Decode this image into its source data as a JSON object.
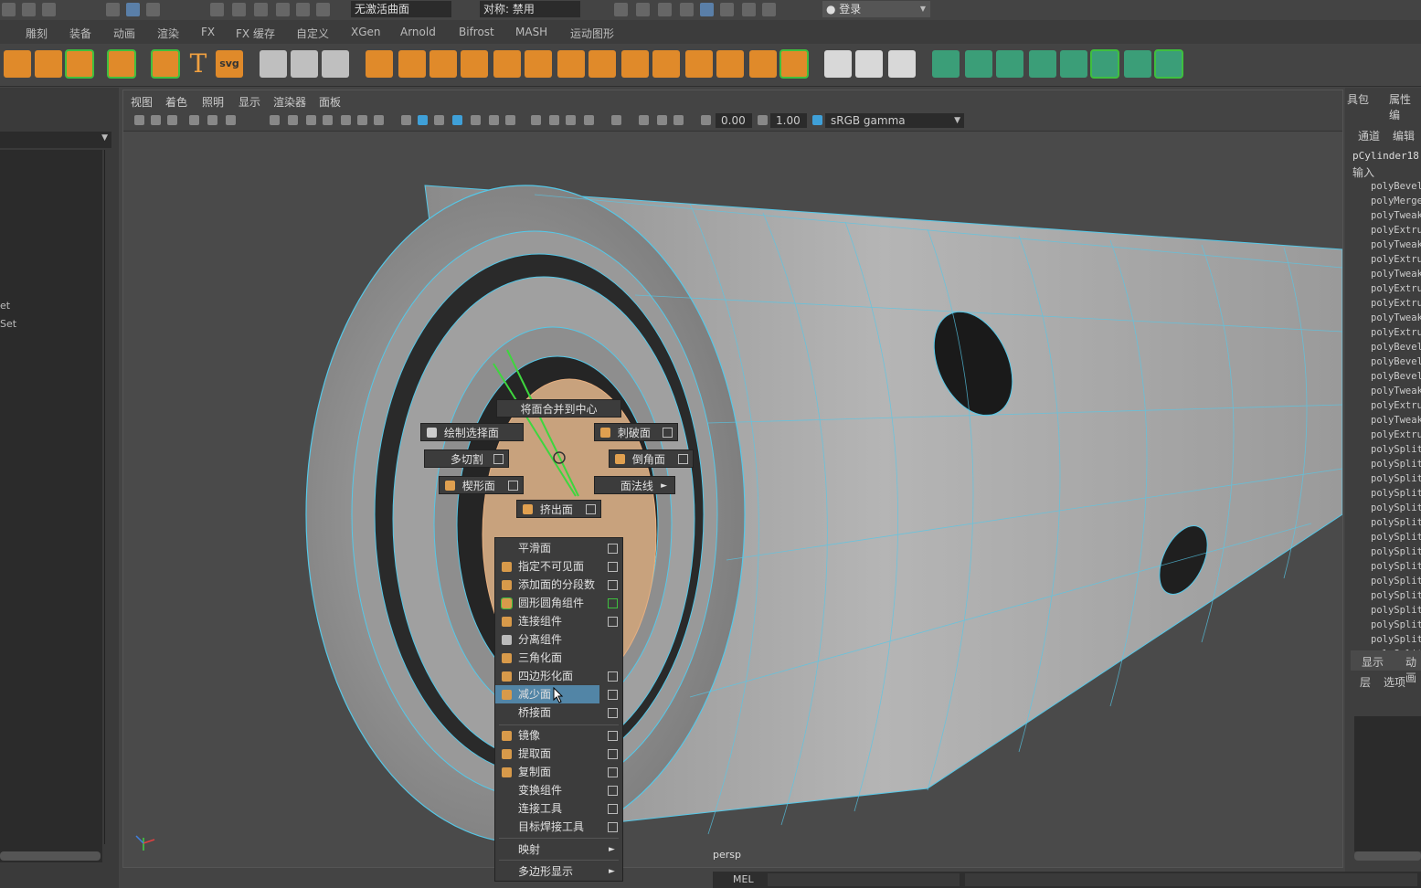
{
  "statusbar": {
    "surface_dropdown": "无激活曲面",
    "symmetry_dropdown": "对称: 禁用",
    "login": "登录"
  },
  "shelf_tabs": [
    "雕刻",
    "装备",
    "动画",
    "渲染",
    "FX",
    "FX 缓存",
    "自定义",
    "XGen",
    "Arnold",
    "Bifrost",
    "MASH",
    "运动图形"
  ],
  "shelf": {
    "text_tool": "T",
    "svg_tool": "svg"
  },
  "left_panel": {
    "items": [
      "et",
      "Set"
    ]
  },
  "viewport": {
    "menu": [
      "视图",
      "着色",
      "照明",
      "显示",
      "渲染器",
      "面板"
    ],
    "exposure": "0.00",
    "gamma": "1.00",
    "color_space": "sRGB gamma",
    "camera_label": "persp"
  },
  "marking_menu": {
    "north": "将面合并到中心",
    "northwest": "绘制选择面",
    "northeast": "刺破面",
    "west": "多切割",
    "east": "倒角面",
    "southwest": "楔形面",
    "southeast": "面法线",
    "south": "挤出面"
  },
  "popup_menu": {
    "items": [
      {
        "label": "平滑面",
        "box": true
      },
      {
        "label": "指定不可见面",
        "box": true
      },
      {
        "label": "添加面的分段数",
        "box": true
      },
      {
        "label": "圆形圆角组件",
        "box": true
      },
      {
        "label": "连接组件",
        "box": true
      },
      {
        "label": "分离组件",
        "box": false
      },
      {
        "label": "三角化面",
        "box": false
      },
      {
        "label": "四边形化面",
        "box": true
      },
      {
        "label": "减少面",
        "box": true,
        "highlighted": true
      },
      {
        "label": "桥接面",
        "box": true
      },
      {
        "label": "镜像",
        "box": true
      },
      {
        "label": "提取面",
        "box": true
      },
      {
        "label": "复制面",
        "box": true
      },
      {
        "label": "变换组件",
        "box": true
      },
      {
        "label": "连接工具",
        "box": true
      },
      {
        "label": "目标焊接工具",
        "box": true
      },
      {
        "label": "映射",
        "submenu": true
      },
      {
        "label": "多边形显示",
        "submenu": true
      }
    ]
  },
  "right_panel": {
    "tabs": [
      "具包",
      "属性编"
    ],
    "channel_tabs": [
      "通道",
      "编辑"
    ],
    "object_name": "pCylinder18",
    "inputs_label": "输入",
    "history": [
      "polyBevel",
      "polyMerge",
      "polyTweak",
      "polyExtrude",
      "polyTweak",
      "polyExtrude",
      "polyTweak",
      "polyExtrude",
      "polyExtrude",
      "polyTweak",
      "polyExtrude",
      "polyBevel",
      "polyBevel",
      "polyBevel",
      "polyTweak",
      "polyExtrude",
      "polyTweak",
      "polyExtrude",
      "polySplit",
      "polySplit",
      "polySplit",
      "polySplit",
      "polySplit",
      "polySplit",
      "polySplit",
      "polySplit",
      "polySplit",
      "polySplit",
      "polySplit",
      "polySplit",
      "polySplit",
      "polySplit",
      "polySplit"
    ],
    "layer_tabs": [
      "显示",
      "动画"
    ],
    "layer_menu": [
      "层",
      "选项"
    ]
  },
  "command_line": {
    "label": "MEL"
  }
}
